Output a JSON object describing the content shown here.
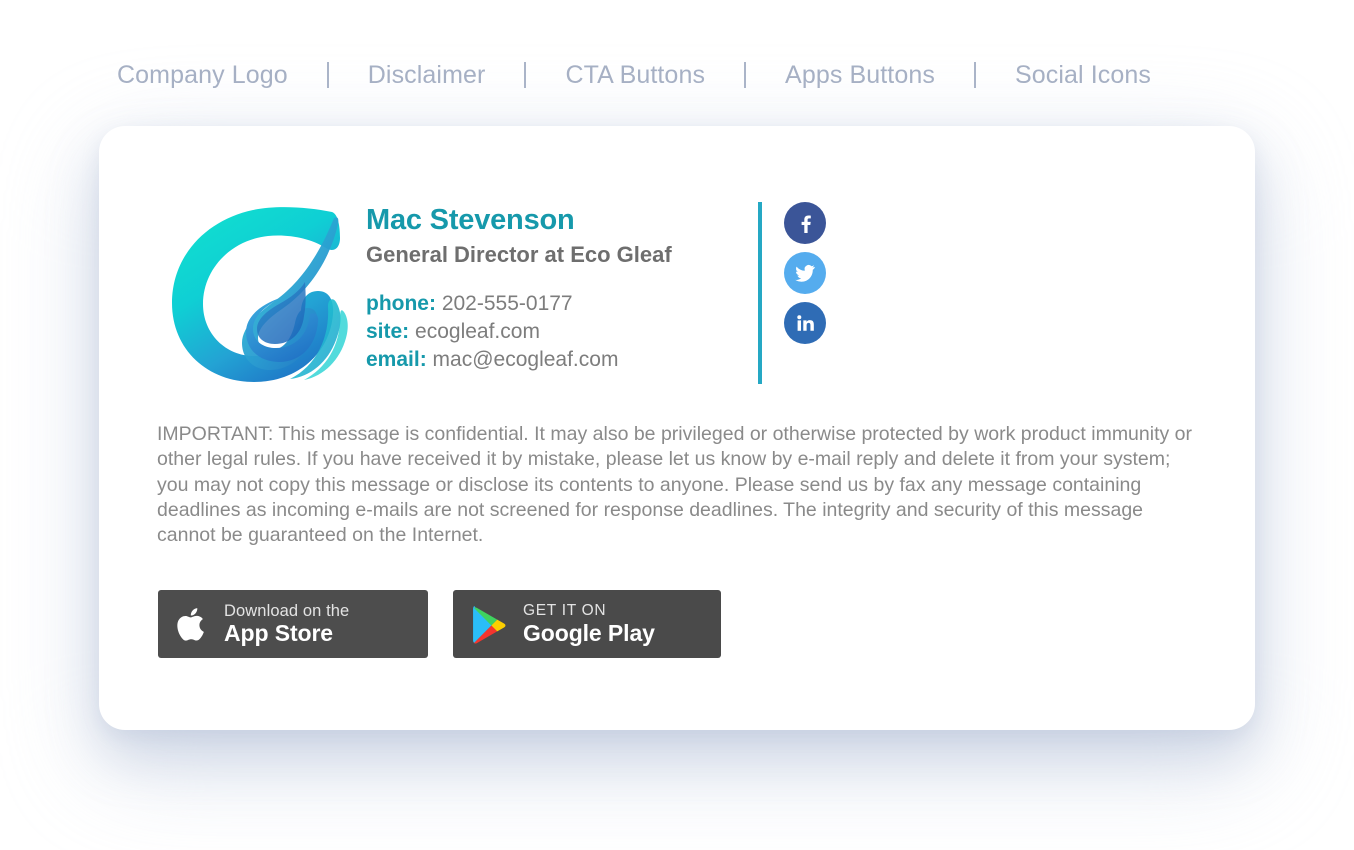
{
  "legend": {
    "items": [
      {
        "label": "Company Logo"
      },
      {
        "label": "Disclaimer"
      },
      {
        "label": "CTA Buttons"
      },
      {
        "label": "Apps Buttons"
      },
      {
        "label": "Social Icons"
      }
    ]
  },
  "signature": {
    "logo": {
      "icon": "eco-gleaf-swirl-logo",
      "gradient_from": "#00e5d0",
      "gradient_to": "#1f6fc4"
    },
    "name": "Mac Stevenson",
    "title": "General Director at Eco Gleaf",
    "accent_color": "#1699ab",
    "rule_color": "#25a8c4",
    "contacts": [
      {
        "label": "phone:",
        "value": "202-555-0177"
      },
      {
        "label": "site:",
        "value": "ecogleaf.com"
      },
      {
        "label": "email:",
        "value": "mac@ecogleaf.com"
      }
    ],
    "social": [
      {
        "name": "facebook",
        "label": "f",
        "color": "#3b5598"
      },
      {
        "name": "twitter",
        "label": "",
        "color": "#55acee"
      },
      {
        "name": "linkedin",
        "label": "in",
        "color": "#2f6cb5"
      }
    ],
    "disclaimer": "IMPORTANT: This message is confidential. It may also be privileged or otherwise protected by work product immunity or other legal rules. If you have received it by mistake, please let us know by e-mail reply and delete it from your system; you may not copy this message or disclose its contents to anyone. Please send us by fax any message containing deadlines as incoming e-mails are not screened for response deadlines. The integrity and security of this message cannot be guaranteed on the Internet.",
    "app_badges": [
      {
        "name": "app-store",
        "icon": "apple-icon",
        "small_text": "Download on the",
        "big_text": "App Store",
        "background": "#4d4d4d"
      },
      {
        "name": "google-play",
        "icon": "google-play-icon",
        "small_text": "GET IT ON",
        "big_text": "Google Play",
        "background": "#4a4a4a"
      }
    ]
  }
}
